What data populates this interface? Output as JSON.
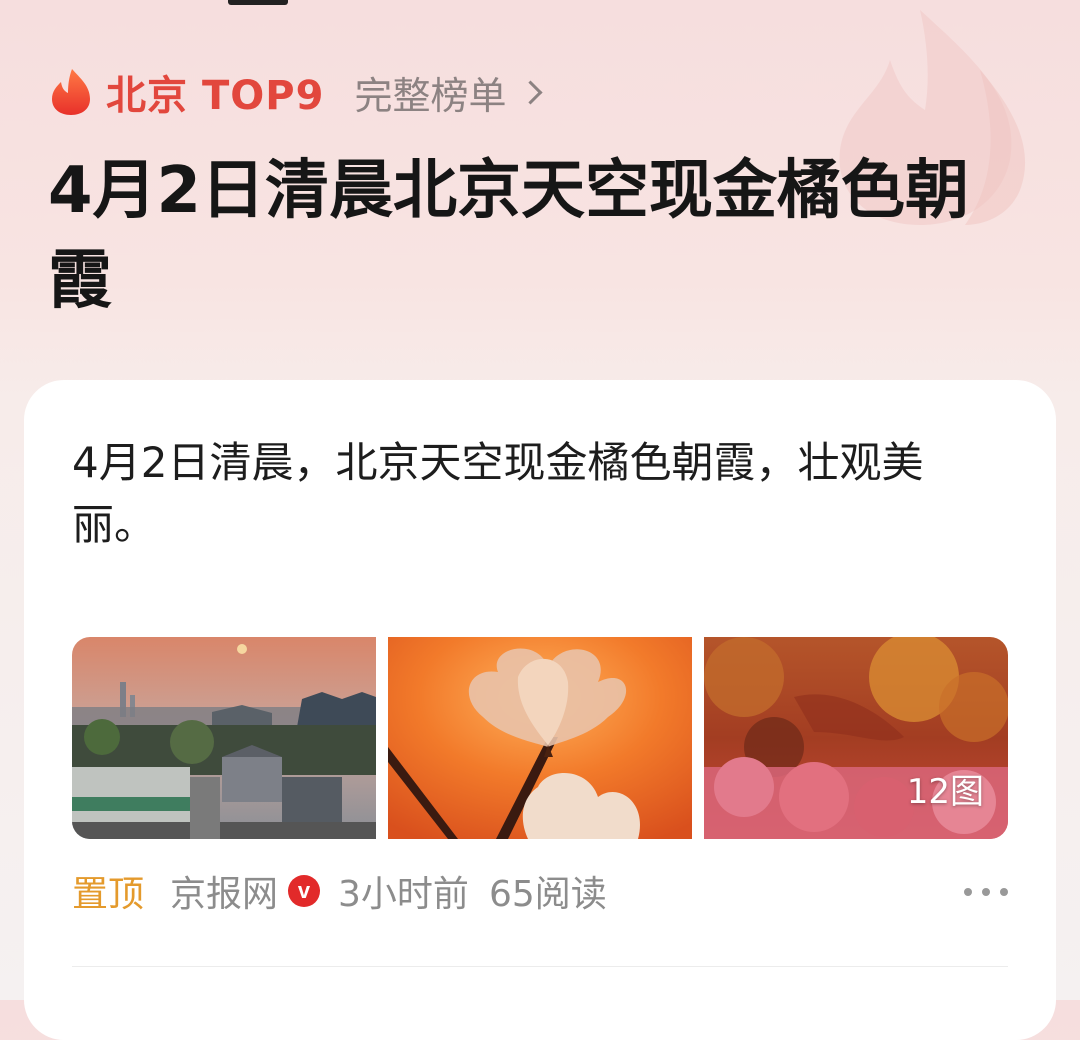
{
  "hot_header": {
    "city": "北京",
    "rank_label": "TOP9",
    "full_list_label": "完整榜单"
  },
  "page_title": "4月2日清晨北京天空现金橘色朝霞",
  "post": {
    "text": "4月2日清晨，北京天空现金橘色朝霞，壮观美丽。",
    "photo_count": "12图",
    "pin_label": "置顶",
    "source": "京报网",
    "verified_mark": "v",
    "time_ago": "3小时前",
    "reads": "65阅读"
  },
  "icons": [
    "fire-icon",
    "chevron-right-icon",
    "verified-icon",
    "more-icon"
  ],
  "colors": {
    "accent_red": "#e2473d",
    "pin_orange": "#e49a2c",
    "verified_red": "#e22a2a"
  }
}
